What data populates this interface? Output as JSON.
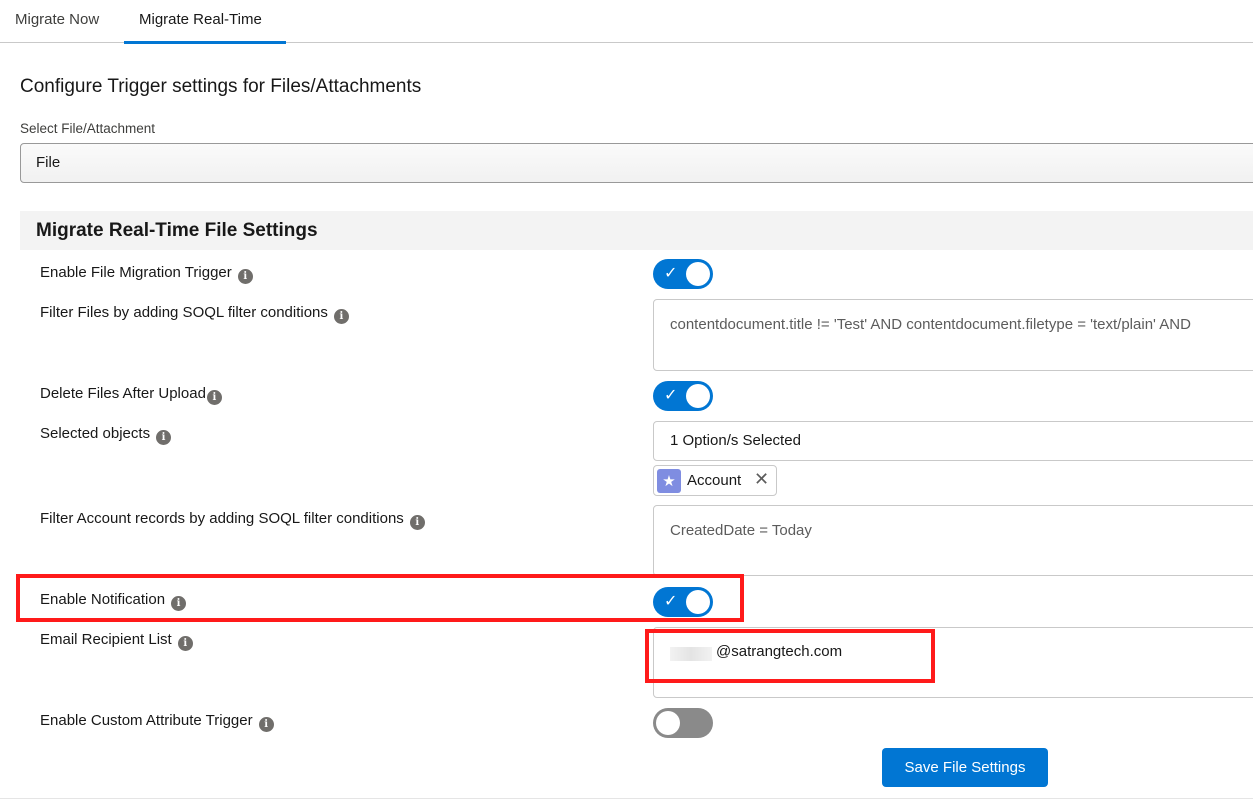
{
  "tabs": [
    {
      "label": "Migrate Now"
    },
    {
      "label": "Migrate Real-Time"
    }
  ],
  "heading": "Configure Trigger settings for Files/Attachments",
  "select": {
    "label": "Select File/Attachment",
    "value": "File"
  },
  "section": {
    "title": "Migrate Real-Time File Settings"
  },
  "settings": {
    "enable_trigger": {
      "label": "Enable File Migration Trigger",
      "on": true
    },
    "filter_files": {
      "label": "Filter Files by adding SOQL filter conditions",
      "value": "contentdocument.title != 'Test' AND contentdocument.filetype = 'text/plain' AND"
    },
    "delete_after": {
      "label": "Delete Files After Upload",
      "on": true
    },
    "selected_objects": {
      "label": "Selected objects",
      "value": "1 Option/s Selected",
      "pills": [
        {
          "label": "Account",
          "icon": "star-icon"
        }
      ]
    },
    "filter_account": {
      "label": "Filter Account records by adding SOQL filter conditions",
      "value": "CreatedDate = Today"
    },
    "enable_notification": {
      "label": "Enable Notification",
      "on": true
    },
    "email_recipients": {
      "label": "Email Recipient List",
      "value": "@satrangtech.com"
    },
    "custom_attribute": {
      "label": "Enable Custom Attribute Trigger",
      "on": false
    }
  },
  "save_button": {
    "label": "Save File Settings"
  },
  "colors": {
    "accent": "#0176d3",
    "highlight": "#ff1a1a",
    "toggle_off": "#8a8a8a"
  }
}
